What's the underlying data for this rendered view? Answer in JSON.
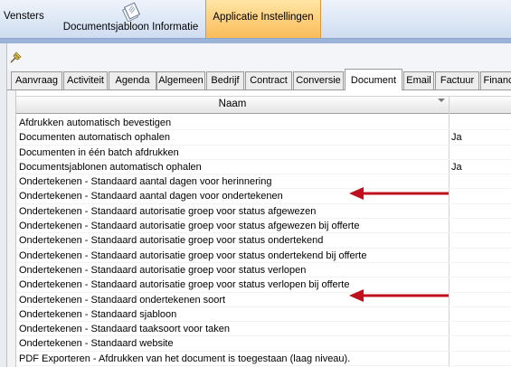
{
  "ribbon": {
    "vensters_label": "Vensters",
    "documentsjabloon_label": "Documentsjabloon Informatie",
    "applicatie_label": "Applicatie Instellingen"
  },
  "tabs": [
    {
      "label": "Aanvraag"
    },
    {
      "label": "Activiteit"
    },
    {
      "label": "Agenda"
    },
    {
      "label": "Algemeen"
    },
    {
      "label": "Bedrijf"
    },
    {
      "label": "Contract"
    },
    {
      "label": "Conversie"
    },
    {
      "label": "Document",
      "active": true
    },
    {
      "label": "Email"
    },
    {
      "label": "Factuur"
    },
    {
      "label": "Financ"
    }
  ],
  "grid": {
    "column_name": "Naam",
    "rows": [
      {
        "name": "Afdrukken automatisch bevestigen",
        "value": ""
      },
      {
        "name": "Documenten automatisch ophalen",
        "value": "Ja"
      },
      {
        "name": "Documenten in één batch afdrukken",
        "value": ""
      },
      {
        "name": "Documentsjablonen automatisch ophalen",
        "value": "Ja"
      },
      {
        "name": "Ondertekenen - Standaard aantal dagen voor herinnering",
        "value": ""
      },
      {
        "name": "Ondertekenen - Standaard aantal dagen voor ondertekenen",
        "value": ""
      },
      {
        "name": "Ondertekenen - Standaard autorisatie groep voor status afgewezen",
        "value": ""
      },
      {
        "name": "Ondertekenen - Standaard autorisatie groep voor status afgewezen bij offerte",
        "value": ""
      },
      {
        "name": "Ondertekenen - Standaard autorisatie groep voor status ondertekend",
        "value": ""
      },
      {
        "name": "Ondertekenen - Standaard autorisatie groep voor status ondertekend bij offerte",
        "value": ""
      },
      {
        "name": "Ondertekenen - Standaard autorisatie groep voor status verlopen",
        "value": ""
      },
      {
        "name": "Ondertekenen - Standaard autorisatie groep voor status verlopen bij offerte",
        "value": ""
      },
      {
        "name": "Ondertekenen - Standaard ondertekenen soort",
        "value": ""
      },
      {
        "name": "Ondertekenen - Standaard sjabloon",
        "value": ""
      },
      {
        "name": "Ondertekenen - Standaard taaksoort voor taken",
        "value": ""
      },
      {
        "name": "Ondertekenen - Standaard website",
        "value": ""
      },
      {
        "name": "PDF Exporteren - Afdrukken van het document is toegestaan (laag niveau).",
        "value": ""
      }
    ]
  },
  "annotations": {
    "arrow_color": "#c0101e",
    "highlighted_rows": [
      5,
      12
    ]
  },
  "colors": {
    "ribbon_active": "#fdd07e",
    "ribbon_bg": "#dde8f6"
  }
}
